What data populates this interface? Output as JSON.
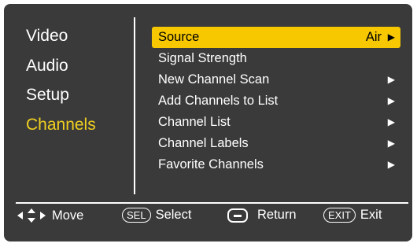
{
  "categories": [
    "Video",
    "Audio",
    "Setup",
    "Channels"
  ],
  "active_category": "Channels",
  "options": [
    {
      "label": "Source",
      "value": "Air",
      "arrow": "▶"
    },
    {
      "label": "Signal Strength",
      "value": "",
      "arrow": ""
    },
    {
      "label": "New Channel Scan",
      "value": "",
      "arrow": "▶"
    },
    {
      "label": "Add Channels to List",
      "value": "",
      "arrow": "▶"
    },
    {
      "label": "Channel List",
      "value": "",
      "arrow": "▶"
    },
    {
      "label": "Channel Labels",
      "value": "",
      "arrow": "▶"
    },
    {
      "label": "Favorite Channels",
      "value": "",
      "arrow": "▶"
    }
  ],
  "legend": {
    "move_label": "Move",
    "select_key": "SEL",
    "select_label": "Select",
    "return_label": "Return",
    "exit_key": "EXIT",
    "exit_label": "Exit"
  },
  "colors": {
    "panel": "#3a3a3a",
    "highlight": "#f7c800",
    "active_category": "#f0d020"
  }
}
